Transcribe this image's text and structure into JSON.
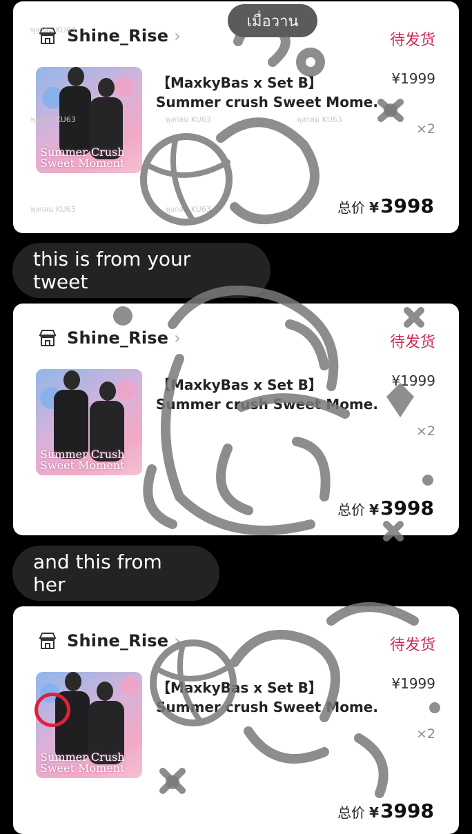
{
  "date_pill": "เมื่อวาน",
  "colors": {
    "status": "#cf2a56",
    "bubble_bg": "#232323",
    "highlight_circle": "#e0213a",
    "sticker_gray": "#7a7a7a"
  },
  "watermark": "พุงกลม KU63",
  "orders": [
    {
      "shop_name": "Shine_Rise",
      "status": "待发货",
      "product_title_line1": "【MaxkyBas x Set B】",
      "product_title_line2": "Summer crush Sweet Mome...",
      "thumbnail_text": "Summer Crush Sweet Moment",
      "unit_price": "¥1999",
      "quantity": "×2",
      "total_label": "总价",
      "total_currency": "¥",
      "total_value": "3998"
    },
    {
      "shop_name": "Shine_Rise",
      "status": "待发货",
      "product_title_line1": "【MaxkyBas x Set B】",
      "product_title_line2": "Summer crush Sweet Mome...",
      "thumbnail_text": "Summer Crush Sweet Moment",
      "unit_price": "¥1999",
      "quantity": "×2",
      "total_label": "总价",
      "total_currency": "¥",
      "total_value": "3998"
    },
    {
      "shop_name": "Shine_Rise",
      "status": "待发货",
      "product_title_line1": "【MaxkyBas x Set B】",
      "product_title_line2": "Summer crush Sweet Mome...",
      "thumbnail_text": "Summer Crush Sweet Moment",
      "unit_price": "¥1999",
      "quantity": "×2",
      "total_label": "总价",
      "total_currency": "¥",
      "total_value": "3998"
    }
  ],
  "messages": [
    {
      "text": "this is from your tweet"
    },
    {
      "text": "and this from her"
    }
  ]
}
